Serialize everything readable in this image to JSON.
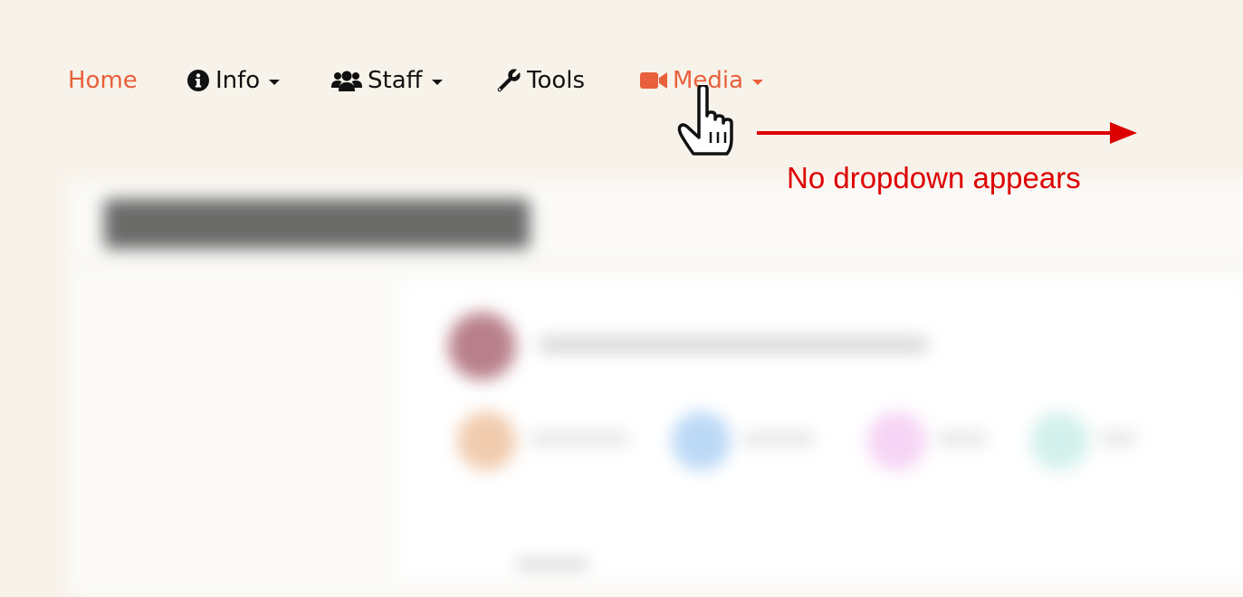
{
  "colors": {
    "background": "#f8f3ea",
    "accent": "#e8603c",
    "text": "#111111",
    "annotation": "#dd0000"
  },
  "nav": {
    "items": [
      {
        "label": "Home",
        "icon": null,
        "dropdown": false,
        "active": true
      },
      {
        "label": "Info",
        "icon": "info-circle-icon",
        "dropdown": true,
        "active": false
      },
      {
        "label": "Staff",
        "icon": "users-icon",
        "dropdown": true,
        "active": false
      },
      {
        "label": "Tools",
        "icon": "wrench-icon",
        "dropdown": false,
        "active": false
      },
      {
        "label": "Media",
        "icon": "video-camera-icon",
        "dropdown": true,
        "active": true,
        "hovered": true
      }
    ]
  },
  "annotation": {
    "text": "No dropdown appears",
    "pointer": "hand-cursor-icon",
    "arrow": "arrow-right-icon"
  }
}
